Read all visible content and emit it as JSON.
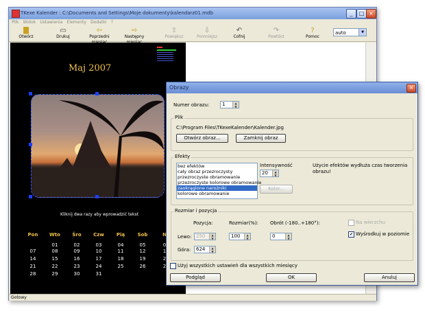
{
  "app": {
    "title": "TKexe Kalender : C:\\Documents and Settings\\Moje dokumenty\\kalendarz01.mdb",
    "menu": [
      "Plik",
      "Widok",
      "Ustawienia",
      "Elementy",
      "Dodatki",
      "?"
    ],
    "toolbar": {
      "open": "Otwórz",
      "print": "Drukuj",
      "prev_month": "Poprzedni miesiąc",
      "next_month": "Następny miesiąc",
      "enlarge": "Powiększ",
      "shrink": "Pomniejsz",
      "undo": "Cofnij",
      "redo": "Powtórz",
      "help": "Pomoc",
      "zoom": "auto"
    },
    "status": "Gotowy"
  },
  "calendar": {
    "month_title": "Maj 2007",
    "hint": "Kliknij dwa razy aby wprowadzić tekst",
    "day_names": [
      "Pon",
      "Wto",
      "Śro",
      "Czw",
      "Pią",
      "Sob",
      "N"
    ],
    "weeks": [
      [
        "",
        "01",
        "02",
        "03",
        "04",
        "05",
        "0"
      ],
      [
        "07",
        "08",
        "09",
        "10",
        "11",
        "12",
        "1"
      ],
      [
        "14",
        "15",
        "16",
        "17",
        "18",
        "19",
        "2"
      ],
      [
        "21",
        "22",
        "23",
        "24",
        "25",
        "26",
        "2"
      ],
      [
        "28",
        "29",
        "30",
        "31",
        "",
        "",
        ""
      ]
    ]
  },
  "dialog": {
    "title": "Obrazy",
    "image_number_label": "Numer obrazu:",
    "image_number": "1",
    "file_group": "Plik",
    "file_path": "C:\\Program Files\\TKexeKalender\\Kalender.jpg",
    "open_image": "Otwórz obraz...",
    "close_image": "Zamknij obraz",
    "effects_group": "Efekty",
    "effects": [
      "bez efektów",
      "cały obraz przezroczysty",
      "przezroczyste obramowanie",
      "przezroczyste kolorowe obramowanie",
      "zaokrąglone narożniki",
      "kolorowe obramowanie"
    ],
    "selected_effect": "zaokrąglone narożniki",
    "intensity_label": "Intensywność",
    "intensity": "20",
    "color_button": "Kolor...",
    "effects_note": "Użycie efektów wydłuża czas tworzenia obrazu!",
    "size_group": "Rozmiar i pozycja",
    "position_label": "Pozycja:",
    "size_label": "Rozmiar(%):",
    "rotation_label": "Obrót (-180..+180°):",
    "left_label": "Lewo:",
    "left_value": "250",
    "top_label": "Góra:",
    "top_value": "624",
    "size_value": "100",
    "rotation_value": "0",
    "on_top_label": "Na wierzchu",
    "center_label": "Wyśrodkuj w poziomie",
    "use_all_label": "Użyj wszystkich ustawień dla wszystkich miesięcy",
    "preview": "Podgląd",
    "ok": "OK",
    "cancel": "Anuluj"
  }
}
